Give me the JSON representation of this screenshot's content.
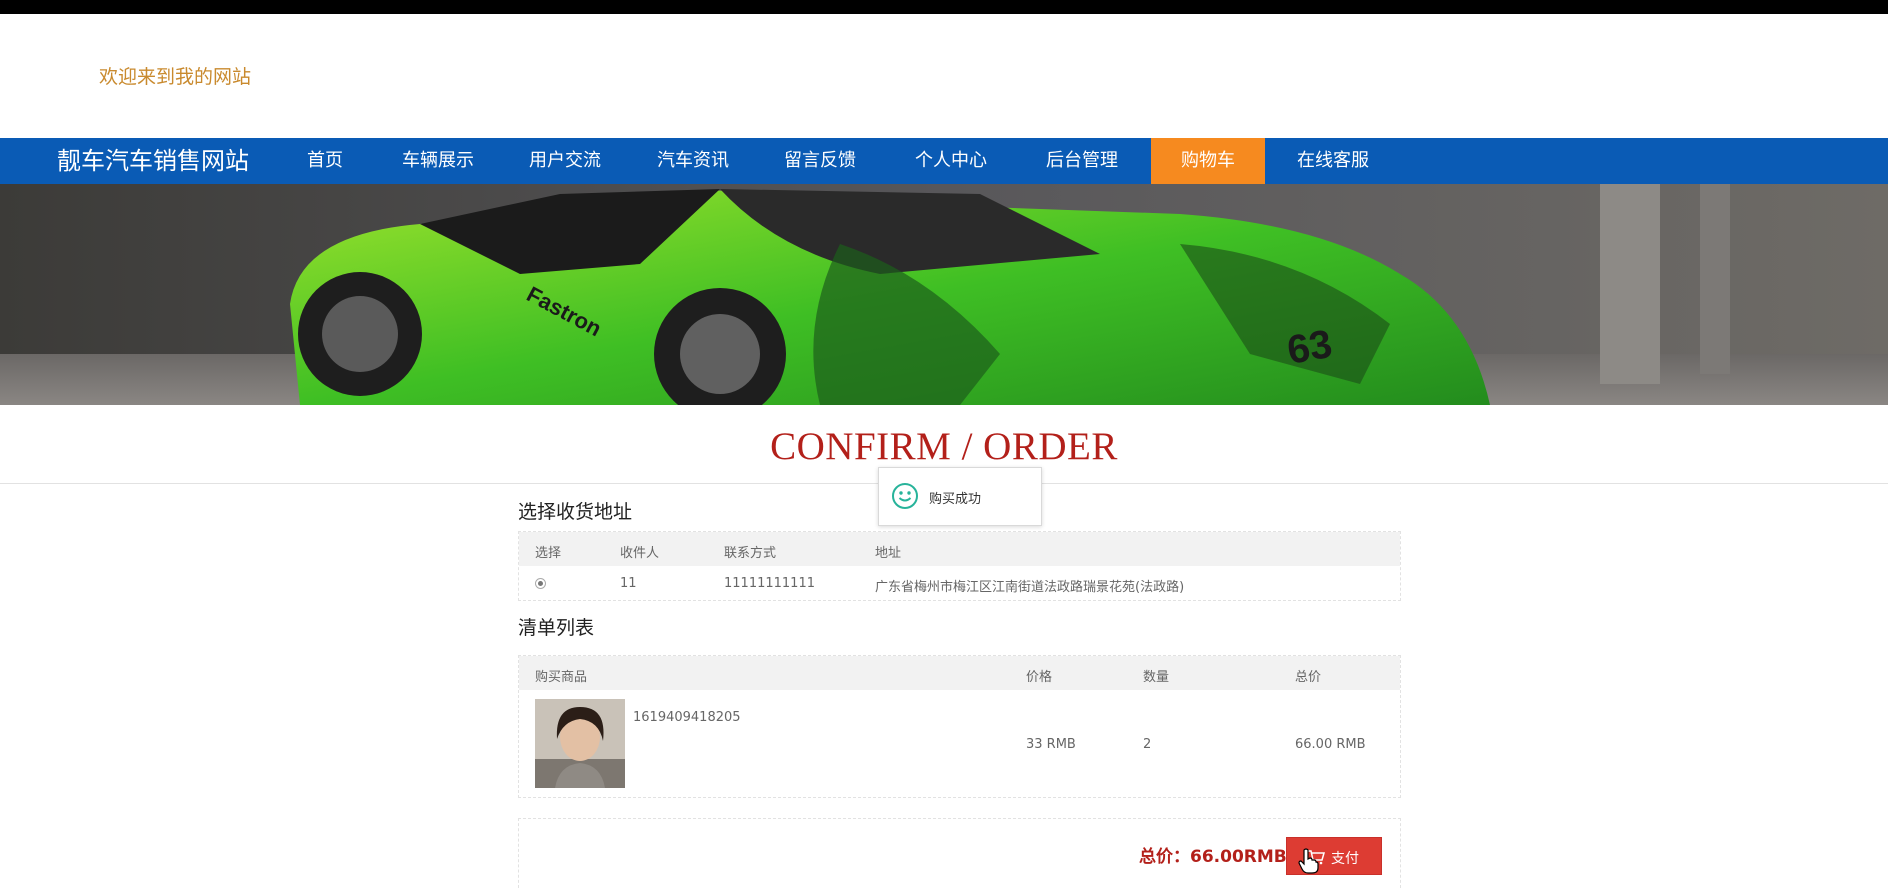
{
  "header": {
    "welcome_text": "欢迎来到我的网站"
  },
  "nav": {
    "brand": "靓车汽车销售网站",
    "items": [
      {
        "label": "首页"
      },
      {
        "label": "车辆展示"
      },
      {
        "label": "用户交流"
      },
      {
        "label": "汽车资讯"
      },
      {
        "label": "留言反馈"
      },
      {
        "label": "个人中心"
      },
      {
        "label": "后台管理"
      },
      {
        "label": "购物车",
        "active": true
      },
      {
        "label": "在线客服"
      }
    ],
    "colors": {
      "bar": "#0a5bb5",
      "active": "#f68a1f"
    }
  },
  "page": {
    "title": "CONFIRM / ORDER"
  },
  "toast": {
    "icon": "smiley-icon",
    "text": "购买成功"
  },
  "address": {
    "section_title": "选择收货地址",
    "columns": [
      "选择",
      "收件人",
      "联系方式",
      "地址"
    ],
    "rows": [
      {
        "selected": true,
        "recipient": "11",
        "phone": "11111111111",
        "address": "广东省梅州市梅江区江南街道法政路瑞景花苑(法政路)"
      }
    ]
  },
  "order": {
    "section_title": "清单列表",
    "columns": [
      "购买商品",
      "价格",
      "数量",
      "总价"
    ],
    "items": [
      {
        "name": "1619409418205",
        "price": "33 RMB",
        "quantity": "2",
        "total": "66.00 RMB"
      }
    ]
  },
  "summary": {
    "total_label": "总价：66.00RMB",
    "pay_label": "支付",
    "pay_icon": "cart-icon",
    "accent": "#dd3c33"
  }
}
